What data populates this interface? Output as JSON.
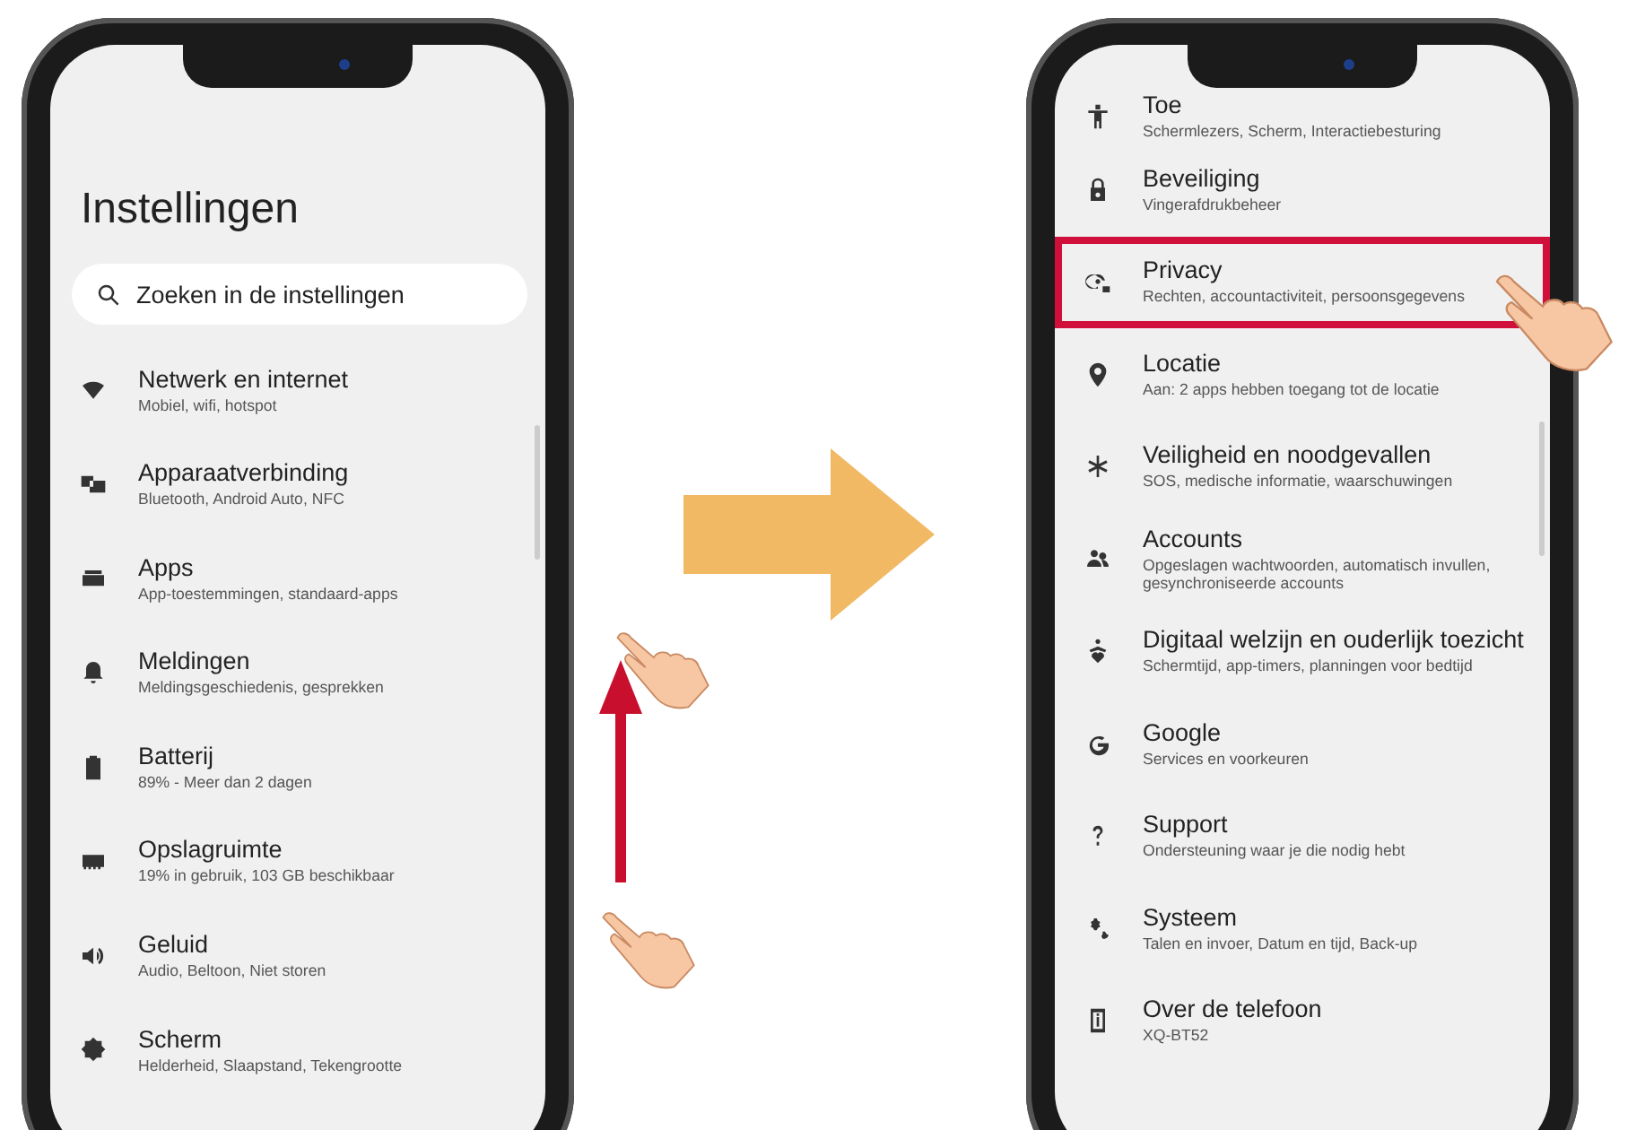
{
  "left_phone": {
    "title": "Instellingen",
    "search": {
      "placeholder": "Zoeken in de instellingen"
    },
    "items": [
      {
        "title": "Netwerk en internet",
        "subtitle": "Mobiel, wifi, hotspot"
      },
      {
        "title": "Apparaatverbinding",
        "subtitle": "Bluetooth, Android Auto, NFC"
      },
      {
        "title": "Apps",
        "subtitle": "App-toestemmingen, standaard-apps"
      },
      {
        "title": "Meldingen",
        "subtitle": "Meldingsgeschiedenis, gesprekken"
      },
      {
        "title": "Batterij",
        "subtitle": "89% - Meer dan 2 dagen"
      },
      {
        "title": "Opslagruimte",
        "subtitle": "19% in gebruik, 103 GB beschikbaar"
      },
      {
        "title": "Geluid",
        "subtitle": "Audio, Beltoon, Niet storen"
      },
      {
        "title": "Scherm",
        "subtitle": "Helderheid, Slaapstand, Tekengrootte"
      }
    ]
  },
  "right_phone": {
    "items": [
      {
        "title": "Toe",
        "subtitle": "Schermlezers, Scherm, Interactiebesturing",
        "selected": false
      },
      {
        "title": "Beveiliging",
        "subtitle": "Vingerafdrukbeheer",
        "selected": false
      },
      {
        "title": "Privacy",
        "subtitle": "Rechten, accountactiviteit, persoonsgegevens",
        "selected": true
      },
      {
        "title": "Locatie",
        "subtitle": "Aan: 2 apps hebben toegang tot de locatie",
        "selected": false
      },
      {
        "title": "Veiligheid en noodgevallen",
        "subtitle": "SOS, medische informatie, waarschuwingen",
        "selected": false
      },
      {
        "title": "Accounts",
        "subtitle": "Opgeslagen wachtwoorden, automatisch invullen, gesynchroniseerde accounts",
        "selected": false
      },
      {
        "title": "Digitaal welzijn en ouderlijk toezicht",
        "subtitle": "Schermtijd, app-timers, planningen voor bedtijd",
        "selected": false
      },
      {
        "title": "Google",
        "subtitle": "Services en voorkeuren",
        "selected": false
      },
      {
        "title": "Support",
        "subtitle": "Ondersteuning waar je die nodig hebt",
        "selected": false
      },
      {
        "title": "Systeem",
        "subtitle": "Talen en invoer, Datum en tijd, Back-up",
        "selected": false
      },
      {
        "title": "Over de telefoon",
        "subtitle": "XQ-BT52",
        "selected": false
      }
    ]
  }
}
